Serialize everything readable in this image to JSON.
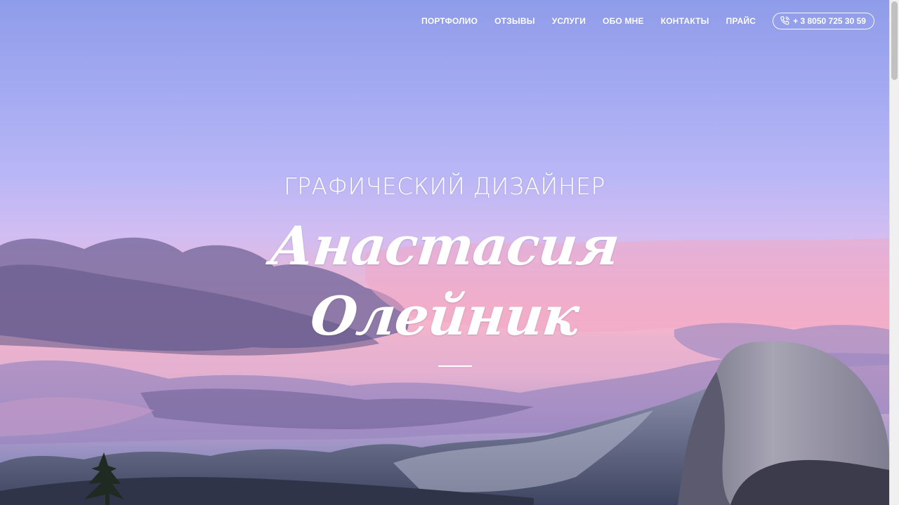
{
  "nav": {
    "items": [
      {
        "label": "ПОРТФОЛИО"
      },
      {
        "label": "ОТЗЫВЫ"
      },
      {
        "label": "УСЛУГИ"
      },
      {
        "label": "ОБО МНЕ"
      },
      {
        "label": "КОНТАКТЫ"
      },
      {
        "label": "ПРАЙС"
      }
    ],
    "phone": {
      "label": "+ 3 8050 725 30 59",
      "icon": "phone-icon"
    }
  },
  "hero": {
    "subtitle": "ГРАФИЧЕСКИЙ ДИЗАЙНЕР",
    "name_line_1": "Анастасия",
    "name_line_2": "Олейник"
  },
  "colors": {
    "text": "#ffffff",
    "sky_top": "#8f9ce9",
    "sky_pink": "#f3b3c8",
    "cloud_dark": "#7b6f9f",
    "mountain": "#4e5475"
  }
}
